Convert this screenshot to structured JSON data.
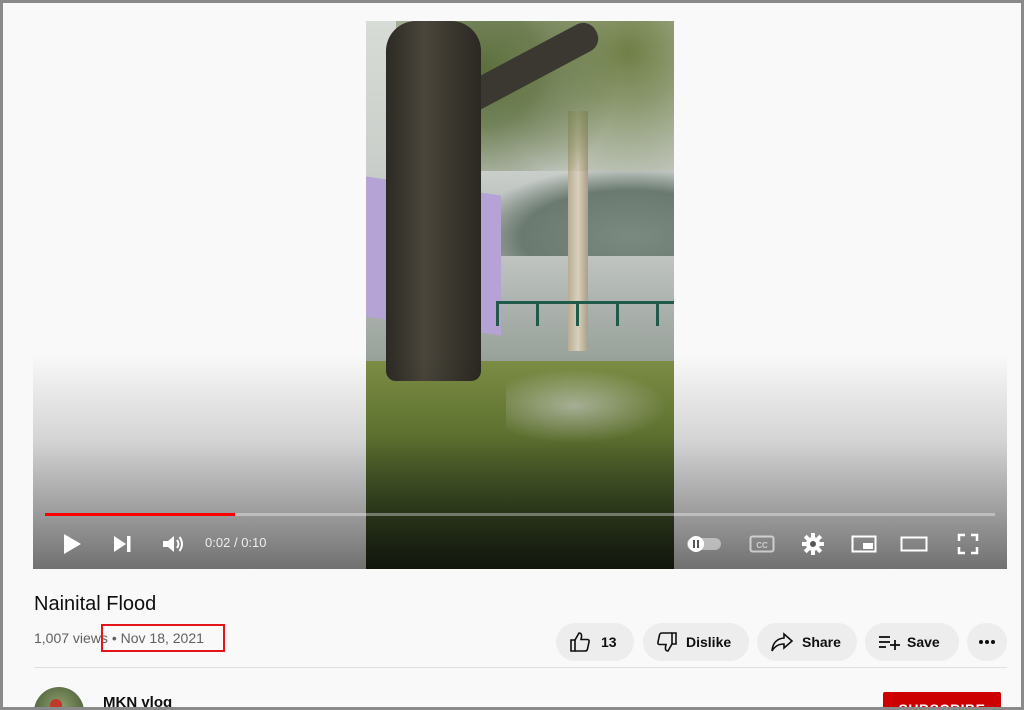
{
  "player": {
    "time_current": "0:02",
    "time_separator": "/",
    "time_total": "0:10",
    "progress_fraction": 0.2,
    "progress_color": "#ff0000",
    "controls": {
      "play": "play-icon",
      "next": "next-icon",
      "volume": "volume-icon",
      "autoplay": "autoplay-toggle-icon",
      "captions": "cc-icon",
      "settings": "gear-icon",
      "miniplayer": "miniplayer-icon",
      "theater": "theater-icon",
      "fullscreen": "fullscreen-icon"
    }
  },
  "video": {
    "title": "Nainital Flood",
    "views": "1,007 views",
    "separator": "•",
    "date": "Nov 18, 2021",
    "highlight_color": "#e4141b"
  },
  "actions": {
    "like_count": "13",
    "dislike_label": "Dislike",
    "share_label": "Share",
    "save_label": "Save",
    "more": "more-icon"
  },
  "channel": {
    "name": "MKN vlog",
    "subscribe_label": "SUBSCRIBE",
    "subscribe_color": "#cc0000"
  }
}
